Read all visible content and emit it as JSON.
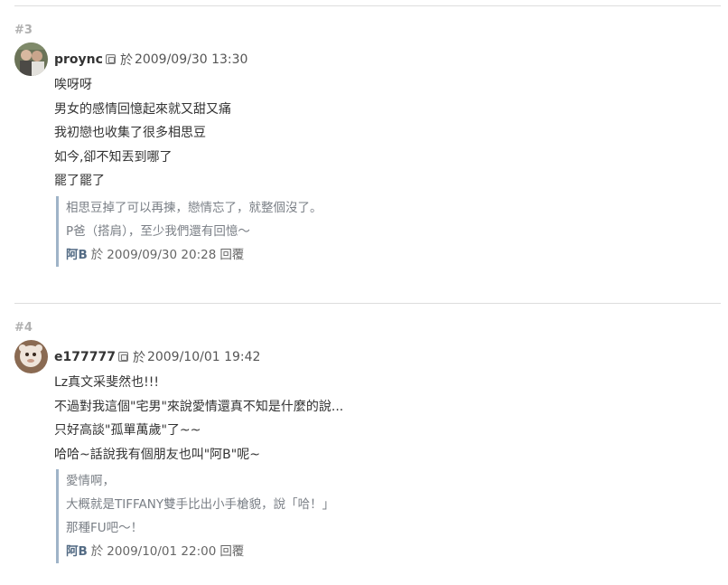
{
  "posts": [
    {
      "floor": "#3",
      "username": "proync",
      "at_word": "於",
      "timestamp": "2009/09/30 13:30",
      "lines": [
        "唉呀呀",
        "男女的感情回憶起來就又甜又痛",
        "我初戀也收集了很多相思豆",
        "如今,卻不知丟到哪了",
        "罷了罷了"
      ],
      "reply": {
        "lines": [
          "相思豆掉了可以再揀，戀情忘了，就整個沒了。",
          "P爸（搭肩），至少我們還有回憶～"
        ],
        "author": "阿B",
        "at_word": "於",
        "timestamp": "2009/09/30 20:28",
        "label": "回覆"
      }
    },
    {
      "floor": "#4",
      "username": "e177777",
      "at_word": "於",
      "timestamp": "2009/10/01 19:42",
      "lines": [
        "Lz真文采斐然也!!!",
        "不過對我這個\"宅男\"來說愛情還真不知是什麼的說...",
        "只好高談\"孤單萬歲\"了~~",
        "哈哈~話說我有個朋友也叫\"阿B\"呢~"
      ],
      "reply": {
        "lines": [
          "愛情啊，",
          "大概就是TIFFANY雙手比出小手槍貌，說「哈！」",
          "那種FU吧～！"
        ],
        "author": "阿B",
        "at_word": "於",
        "timestamp": "2009/10/01 22:00",
        "label": "回覆"
      }
    }
  ],
  "icons": {
    "avatar": "user-avatar-photo",
    "badge": "member-badge-icon"
  }
}
